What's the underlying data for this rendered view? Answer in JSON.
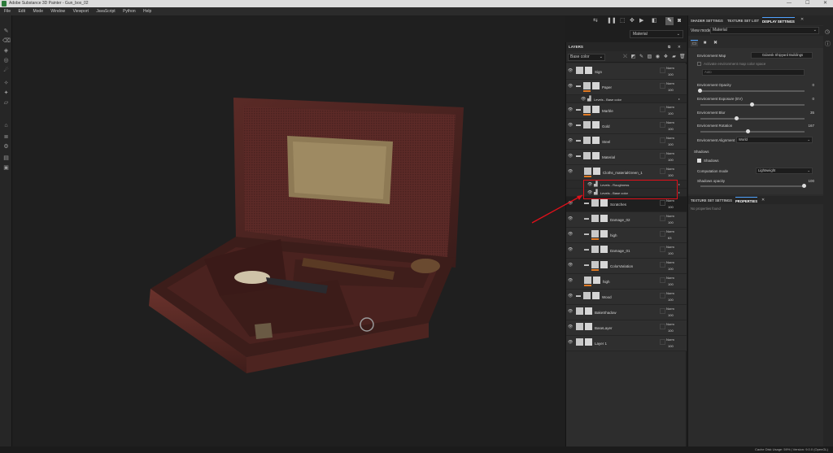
{
  "window": {
    "title": "Adobe Substance 3D Painter - Gun_box_02",
    "controls": {
      "minimize": "—",
      "maximize": "☐",
      "close": "✕"
    }
  },
  "menu": [
    "File",
    "Edit",
    "Mode",
    "Window",
    "Viewport",
    "JavaScript",
    "Python",
    "Help"
  ],
  "viewport": {
    "material_select": "Material"
  },
  "layers_panel": {
    "title": "LAYERS",
    "channel": "Base color",
    "layers": [
      {
        "name": "Sign",
        "blend": "Norm",
        "opacity": "100",
        "kind": "layer"
      },
      {
        "name": "Paper",
        "blend": "Norm",
        "opacity": "100",
        "kind": "folder"
      },
      {
        "name": "Levels - Base color",
        "kind": "effect"
      },
      {
        "name": "Marble",
        "blend": "Norm",
        "opacity": "100",
        "kind": "folder"
      },
      {
        "name": "Gold",
        "blend": "Norm",
        "opacity": "100",
        "kind": "folder"
      },
      {
        "name": "Steel",
        "blend": "Norm",
        "opacity": "100",
        "kind": "folder"
      },
      {
        "name": "Material",
        "blend": "Norm",
        "opacity": "100",
        "kind": "folder"
      },
      {
        "name": "Cloths_materialGreen_1",
        "blend": "Norm",
        "opacity": "100",
        "kind": "layer"
      },
      {
        "name": "Levels - Roughness",
        "kind": "effect"
      },
      {
        "name": "Levels - Base color",
        "kind": "effect"
      },
      {
        "name": "Scratches",
        "blend": "Norm",
        "opacity": "100",
        "kind": "folder"
      },
      {
        "name": "Damage_02",
        "blend": "Norm",
        "opacity": "100",
        "kind": "folder"
      },
      {
        "name": "high",
        "blend": "Norm",
        "opacity": "63",
        "kind": "folder"
      },
      {
        "name": "Damage_01",
        "blend": "Norm",
        "opacity": "100",
        "kind": "folder"
      },
      {
        "name": "ColorVariation",
        "blend": "Norm",
        "opacity": "100",
        "kind": "folder"
      },
      {
        "name": "high",
        "blend": "Norm",
        "opacity": "100",
        "kind": "layer"
      },
      {
        "name": "Wood",
        "blend": "Norm",
        "opacity": "100",
        "kind": "folder"
      },
      {
        "name": "BakeShadow",
        "blend": "Norm",
        "opacity": "100",
        "kind": "layer"
      },
      {
        "name": "BaseLayer",
        "blend": "Norm",
        "opacity": "100",
        "kind": "layer"
      },
      {
        "name": "Layer 1",
        "blend": "Norm",
        "opacity": "100",
        "kind": "layer"
      }
    ]
  },
  "right_panel": {
    "tabs": [
      "SHADER SETTINGS",
      "TEXTURE SET LIST",
      "DISPLAY SETTINGS"
    ],
    "view_mode_label": "View mode",
    "view_mode_value": "Material",
    "env_map_label": "Environment Map",
    "env_map_value": "Gdansk Shipyard Buildings",
    "env_checkbox_label": "Activate environment map color space",
    "env_color_space": "Auto",
    "env_opacity_label": "Environment Opacity",
    "env_opacity_value": "0",
    "env_opacity_level": 0.0,
    "env_exposure_label": "Environment Exposure (EV)",
    "env_exposure_value": "0",
    "env_exposure_level": 0.5,
    "env_blur_label": "Environment Blur",
    "env_blur_value": "35",
    "env_blur_level": 0.35,
    "env_rotation_label": "Environment Rotation",
    "env_rotation_value": "167",
    "env_rotation_level": 0.46,
    "env_alignment_label": "Environment Alignment",
    "env_alignment_value": "World",
    "shadows_section": "Shadows",
    "shadows_checkbox": "Shadows",
    "computation_mode_label": "Computation mode",
    "computation_mode_value": "Lightweight",
    "shadows_opacity_label": "Shadows opacity",
    "shadows_opacity_value": "100",
    "shadows_opacity_level": 1.0,
    "lower_tabs": [
      "TEXTURE SET SETTINGS",
      "PROPERTIES"
    ],
    "no_properties": "No properties found"
  },
  "status": {
    "text": "Cache Disk Usage: 59% | Version: 9.0.0 (OpenGL)"
  },
  "colors": {
    "accent": "#4fa3ff",
    "highlight_box": "#e0101a",
    "mask_orange": "#e07a24"
  }
}
